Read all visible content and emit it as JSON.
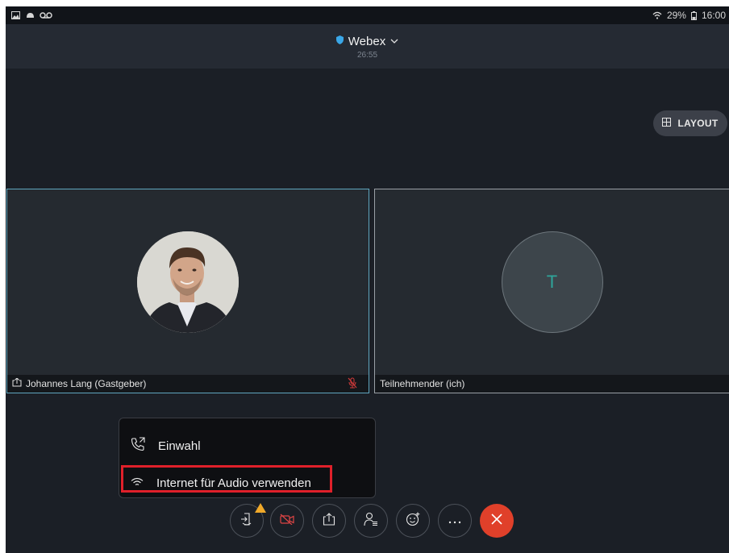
{
  "status_bar": {
    "battery_text": "29%",
    "time": "16:00"
  },
  "header": {
    "app_title": "Webex",
    "elapsed": "26:55"
  },
  "layout_button": {
    "label": "LAYOUT"
  },
  "participants": [
    {
      "name": "Johannes Lang (Gastgeber)",
      "muted": true
    },
    {
      "name": "Teilnehmender (ich)",
      "initial": "T"
    }
  ],
  "audio_menu": {
    "items": [
      {
        "label": "Einwahl",
        "icon": "phone-outgoing-icon"
      },
      {
        "label": "Internet für Audio verwenden",
        "icon": "wifi-icon",
        "highlighted": true
      }
    ]
  },
  "controls": [
    {
      "name": "audio-button",
      "icon": "audio-connect-icon",
      "warning": true
    },
    {
      "name": "video-button",
      "icon": "video-off-icon"
    },
    {
      "name": "share-button",
      "icon": "share-icon"
    },
    {
      "name": "participants-button",
      "icon": "participants-icon"
    },
    {
      "name": "reactions-button",
      "icon": "reaction-icon"
    },
    {
      "name": "more-button",
      "icon": "more-icon"
    },
    {
      "name": "end-call-button",
      "icon": "close-icon"
    }
  ],
  "colors": {
    "highlight": "#e0202a",
    "end_call": "#e0402a",
    "active_tile_border": "#5fa6bf",
    "avatar_initial": "#2fa59a"
  }
}
